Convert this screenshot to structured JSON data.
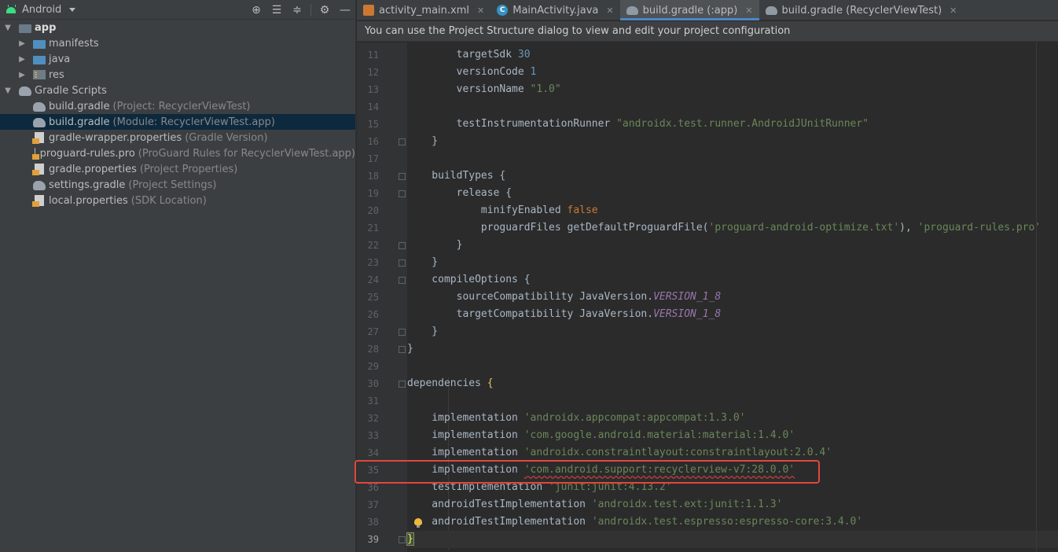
{
  "project_panel": {
    "view_selector": "Android",
    "toolbar_icons": [
      "locate-icon",
      "expand-all-icon",
      "collapse-all-icon",
      "settings-icon",
      "hide-icon"
    ],
    "tree": [
      {
        "label": "app",
        "detail": ""
      },
      {
        "label": "manifests",
        "detail": ""
      },
      {
        "label": "java",
        "detail": ""
      },
      {
        "label": "res",
        "detail": ""
      },
      {
        "label": "Gradle Scripts",
        "detail": ""
      },
      {
        "label": "build.gradle",
        "detail": "(Project: RecyclerViewTest)"
      },
      {
        "label": "build.gradle",
        "detail": "(Module: RecyclerViewTest.app)"
      },
      {
        "label": "gradle-wrapper.properties",
        "detail": "(Gradle Version)"
      },
      {
        "label": "proguard-rules.pro",
        "detail": "(ProGuard Rules for RecyclerViewTest.app)"
      },
      {
        "label": "gradle.properties",
        "detail": "(Project Properties)"
      },
      {
        "label": "settings.gradle",
        "detail": "(Project Settings)"
      },
      {
        "label": "local.properties",
        "detail": "(SDK Location)"
      }
    ]
  },
  "tabs": [
    {
      "label": "activity_main.xml"
    },
    {
      "label": "MainActivity.java"
    },
    {
      "label": "build.gradle (:app)"
    },
    {
      "label": "build.gradle (RecyclerViewTest)"
    }
  ],
  "banner": "You can use the Project Structure dialog to view and edit your project configuration",
  "editor": {
    "line_numbers": [
      "11",
      "12",
      "13",
      "14",
      "15",
      "16",
      "17",
      "18",
      "19",
      "20",
      "21",
      "22",
      "23",
      "24",
      "25",
      "26",
      "27",
      "28",
      "29",
      "30",
      "31",
      "32",
      "33",
      "34",
      "35",
      "36",
      "37",
      "38",
      "39"
    ],
    "code": {
      "l11": {
        "a": "        targetSdk ",
        "b": "30"
      },
      "l12": {
        "a": "        versionCode ",
        "b": "1"
      },
      "l13": {
        "a": "        versionName ",
        "b": "\"1.0\""
      },
      "l15": {
        "a": "        testInstrumentationRunner ",
        "b": "\"androidx.test.runner.AndroidJUnitRunner\""
      },
      "l16": "    }",
      "l18": "    buildTypes {",
      "l19": "        release {",
      "l20": {
        "a": "            minifyEnabled ",
        "b": "false"
      },
      "l21": {
        "a": "            proguardFiles getDefaultProguardFile(",
        "b": "'proguard-android-optimize.txt'",
        "c": "), ",
        "d": "'proguard-rules.pro'"
      },
      "l22": "        }",
      "l23": "    }",
      "l24": "    compileOptions {",
      "l25": {
        "a": "        sourceCompatibility JavaVersion.",
        "b": "VERSION_1_8"
      },
      "l26": {
        "a": "        targetCompatibility JavaVersion.",
        "b": "VERSION_1_8"
      },
      "l27": "    }",
      "l28": "}",
      "l30": {
        "a": "dependencies ",
        "b": "{"
      },
      "l32": {
        "a": "    implementation ",
        "b": "'androidx.appcompat:appcompat:1.3.0'"
      },
      "l33": {
        "a": "    implementation ",
        "b": "'com.google.android.material:material:1.4.0'"
      },
      "l34": {
        "a": "    implementation ",
        "b": "'androidx.constraintlayout:constraintlayout:2.0.4'"
      },
      "l35": {
        "a": "    implementation ",
        "b": "'com.android.support:recyclerview-v7:28.0.0'"
      },
      "l36": {
        "a": "    testImplementation ",
        "b": "'junit:junit:4.13.2'"
      },
      "l37": {
        "a": "    androidTestImplementation ",
        "b": "'androidx.test.ext:junit:1.1.3'"
      },
      "l38": {
        "a": "    androidTestImplementation ",
        "b": "'androidx.test.espresso:espresso-core:3.4.0'"
      },
      "l39": "}"
    }
  },
  "colors": {
    "highlight_box": "#e5453d",
    "keyword": "#cc7832",
    "string": "#6a8759",
    "number": "#6897bb",
    "constant": "#9876aa",
    "active_tab_underline": "#4a88c7"
  }
}
